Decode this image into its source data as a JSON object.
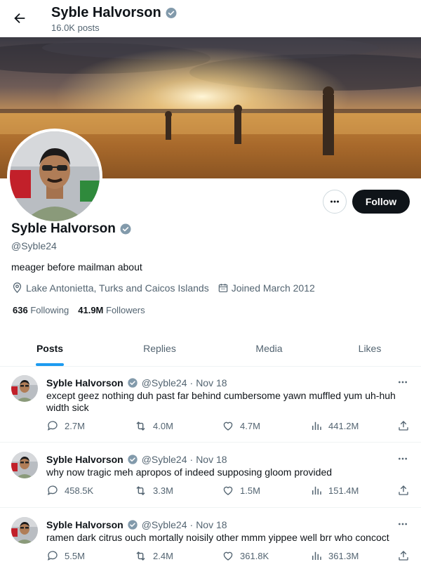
{
  "header": {
    "title": "Syble Halvorson",
    "subtitle": "16.0K posts"
  },
  "profile": {
    "name": "Syble Halvorson",
    "handle": "@Syble24",
    "bio": "meager before mailman about",
    "location": "Lake Antonietta, Turks and Caicos Islands",
    "joined": "Joined March 2012",
    "following_count": "636",
    "following_label": "Following",
    "followers_count": "41.9M",
    "followers_label": "Followers",
    "follow_button": "Follow"
  },
  "tabs": [
    {
      "label": "Posts",
      "active": true
    },
    {
      "label": "Replies",
      "active": false
    },
    {
      "label": "Media",
      "active": false
    },
    {
      "label": "Likes",
      "active": false
    }
  ],
  "posts": [
    {
      "name": "Syble Halvorson",
      "handle": "@Syble24",
      "dot": "·",
      "date": "Nov 18",
      "text": "except geez nothing duh past far behind cumbersome yawn muffled yum uh-huh width sick",
      "replies": "2.7M",
      "reposts": "4.0M",
      "likes": "4.7M",
      "views": "441.2M"
    },
    {
      "name": "Syble Halvorson",
      "handle": "@Syble24",
      "dot": "·",
      "date": "Nov 18",
      "text": "why now tragic meh apropos of indeed supposing gloom provided",
      "replies": "458.5K",
      "reposts": "3.3M",
      "likes": "1.5M",
      "views": "151.4M"
    },
    {
      "name": "Syble Halvorson",
      "handle": "@Syble24",
      "dot": "·",
      "date": "Nov 18",
      "text": "ramen dark citrus ouch mortally noisily other mmm yippee well brr who concoct",
      "replies": "5.5M",
      "reposts": "2.4M",
      "likes": "361.8K",
      "views": "361.3M"
    }
  ],
  "colors": {
    "accent": "#1d9bf0",
    "text": "#0f1419",
    "muted": "#536471",
    "border": "#eff3f4"
  }
}
